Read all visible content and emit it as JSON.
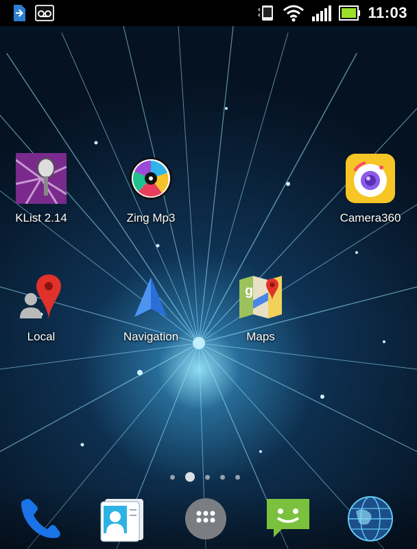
{
  "status_bar": {
    "time": "11:03",
    "icons": [
      "sd-card-usb-icon",
      "voicemail-icon",
      "phone-screen-icon",
      "wifi-icon",
      "signal-icon",
      "battery-icon"
    ]
  },
  "home": {
    "apps": [
      {
        "label": "KList 2.14",
        "icon": "klist-microphone-icon"
      },
      {
        "label": "Zing Mp3",
        "icon": "zing-mp3-disc-icon"
      },
      {
        "label": "Camera360",
        "icon": "camera360-icon"
      },
      {
        "label": "Local",
        "icon": "local-pin-icon"
      },
      {
        "label": "Navigation",
        "icon": "navigation-arrow-icon"
      },
      {
        "label": "Maps",
        "icon": "maps-icon"
      }
    ],
    "page_indicator": {
      "pages": 5,
      "current": 2
    }
  },
  "dock": {
    "items": [
      "phone-icon",
      "contacts-icon",
      "app-drawer-icon",
      "messaging-icon",
      "browser-globe-icon"
    ]
  },
  "colors": {
    "status_bar": "#000000",
    "battery": "#9be028",
    "wallpaper_glow": "#8fe3ff"
  }
}
